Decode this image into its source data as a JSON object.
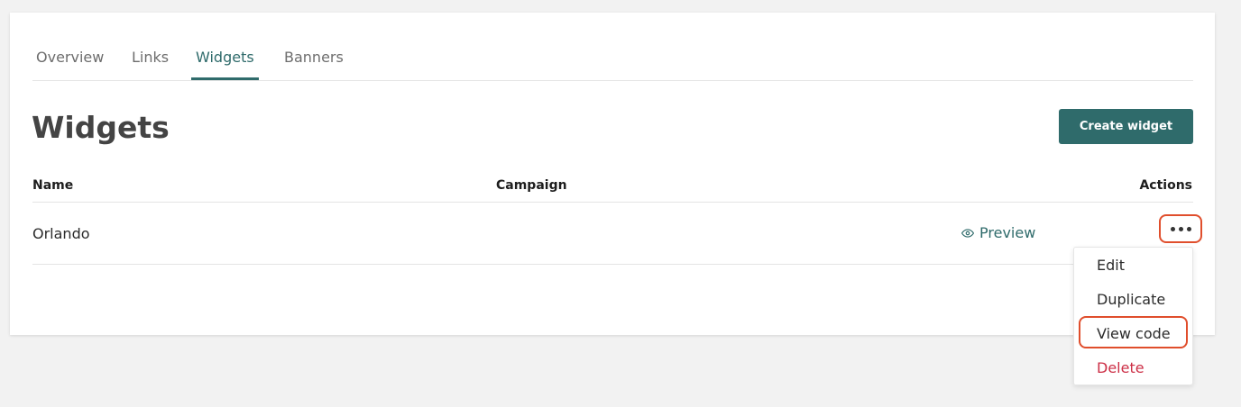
{
  "tabs": [
    {
      "label": "Overview",
      "active": false
    },
    {
      "label": "Links",
      "active": false
    },
    {
      "label": "Widgets",
      "active": true
    },
    {
      "label": "Banners",
      "active": false
    }
  ],
  "page": {
    "title": "Widgets",
    "create_button_label": "Create widget"
  },
  "table": {
    "headers": {
      "name": "Name",
      "campaign": "Campaign",
      "actions": "Actions"
    },
    "rows": [
      {
        "name": "Orlando",
        "campaign": "",
        "preview_label": "Preview"
      }
    ]
  },
  "actions_menu": {
    "items": [
      {
        "label": "Edit"
      },
      {
        "label": "Duplicate"
      },
      {
        "label": "View code",
        "highlighted": true
      },
      {
        "label": "Delete",
        "danger": true
      }
    ]
  },
  "icons": {
    "preview": "eye-icon",
    "more": "more-horizontal-icon"
  },
  "colors": {
    "accent": "#2f6b6b",
    "danger": "#cc2e45",
    "highlight": "#e04e2c",
    "background": "#f2f2f2"
  }
}
